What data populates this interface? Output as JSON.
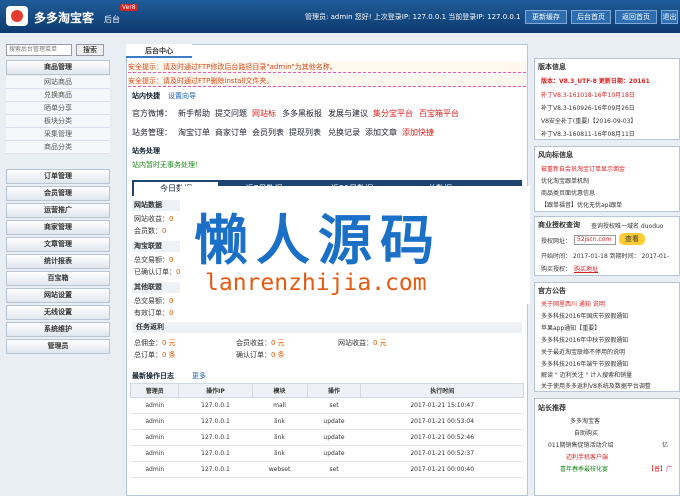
{
  "header": {
    "brand": "多多淘宝客",
    "brand_sub": "后台",
    "version_badge": "Ver8",
    "user_info": "管理员: admin 您好! 上次登录IP: 127.0.0.1 当前登录IP: 127.0.0.1",
    "buttons": [
      "更新缓存",
      "后台首页",
      "返回首页",
      "退出"
    ]
  },
  "sidebar": {
    "search_placeholder": "搜索后台管理菜单",
    "search_button": "搜索",
    "groups": [
      {
        "label": "商品管理",
        "items": [
          "网站商品",
          "兑换商品",
          "晒单分享",
          "板块分类",
          "采集管理",
          "商品分类"
        ]
      },
      {
        "label": "订单管理",
        "items": []
      },
      {
        "label": "会员管理",
        "items": []
      },
      {
        "label": "运营推广",
        "items": []
      },
      {
        "label": "商家管理",
        "items": []
      },
      {
        "label": "文章管理",
        "items": []
      },
      {
        "label": "统计报表",
        "items": []
      },
      {
        "label": "百宝箱",
        "items": []
      },
      {
        "label": "网站设置",
        "items": []
      },
      {
        "label": "无线设置",
        "items": []
      },
      {
        "label": "系统维护",
        "items": []
      },
      {
        "label": "管理员",
        "items": []
      }
    ]
  },
  "center": {
    "tab": "后台中心",
    "notices": [
      "安全提示：请及时通过FTP修改后台路径目录\"admin\"为其他名称。",
      "安全提示：请及时通过FTP删除install文件夹。"
    ],
    "shortcut_title": "站内快捷",
    "shortcut_link": "设置向导",
    "row1": [
      "官方微博：",
      "新手帮助",
      "提交问题",
      "网站标",
      "多多黑板报",
      "发展与建议",
      "集分宝平台",
      "百宝箱平台"
    ],
    "row2": [
      "站务管理：",
      "淘宝订单",
      "商家订单",
      "会员列表",
      "提现列表",
      "兑换记录",
      "添加文章",
      "添加快捷"
    ],
    "process_title": "站务处理",
    "process_text": "站内暂时无事务处理！",
    "stat_tabs": [
      "今日数据",
      "近7日数据",
      "近30日数据",
      "总数据"
    ],
    "stat_groups": [
      {
        "title": "网站数据",
        "lines": [
          [
            "网站收益：",
            "0"
          ],
          [
            "会员数：",
            "0"
          ]
        ]
      },
      {
        "title": "淘宝联盟",
        "lines": [
          [
            "总交易额：",
            "0"
          ],
          [
            "已确认订单：",
            "0"
          ]
        ]
      },
      {
        "title": "其他联盟",
        "lines": [
          [
            "总交易额：",
            "0"
          ],
          [
            "有效订单：",
            "0"
          ]
        ]
      }
    ],
    "task_title": "任务返利",
    "task_lines": [
      [
        "总佣金：",
        "0 元"
      ],
      [
        "会员收益：",
        "0 元"
      ],
      [
        "网站收益：",
        "0 元"
      ],
      [
        "总订单：",
        "0 条"
      ],
      [
        "确认订单：",
        "0 条"
      ]
    ],
    "log_title": "最新操作日志",
    "log_more": "更多",
    "log_headers": [
      "管理员",
      "操作IP",
      "模块",
      "操作",
      "执行时间"
    ],
    "log_rows": [
      [
        "admin",
        "127.0.0.1",
        "mall",
        "set",
        "2017-01-21 15:10:47"
      ],
      [
        "admin",
        "127.0.0.1",
        "link",
        "update",
        "2017-01-21 00:53:04"
      ],
      [
        "admin",
        "127.0.0.1",
        "link",
        "update",
        "2017-01-21 00:52:46"
      ],
      [
        "admin",
        "127.0.0.1",
        "link",
        "update",
        "2017-01-21 00:52:37"
      ],
      [
        "admin",
        "127.0.0.1",
        "webset",
        "set",
        "2017-01-21 00:00:40"
      ]
    ]
  },
  "right": {
    "version_title": "版本信息",
    "version_line": "版本：V8.3_UTF-8 更新日期：20161",
    "version_items": [
      "补丁V8.3-161018-16年10月18日",
      "补丁V8.3-160926-16年09月26日",
      "V8安全补丁(重要)【2016-09-03】",
      "补丁V8.3-160811-16年08月11日"
    ],
    "risk_title": "风向标信息",
    "risk_items": [
      "被重新自会员淘宝订单显示佣金",
      "优化淘宝跟单机制",
      "商品类页面优惠信息",
      "【跟单福音】优化无忧api跟单"
    ],
    "auth_title": "商业授权查询",
    "auth_query": "查询授权唯一域名 duoduo",
    "auth_domain_label": "授权网址：",
    "auth_domain_value": "52jscn.com",
    "auth_button": "查看",
    "auth_dates": "开始时间： 2017-01-18  到期时间： 2017-01-",
    "auth_status_label": "购买授权：",
    "auth_status_value": "购买地址",
    "official_title": "官方公告",
    "official_items": [
      "关于网里西川 通知 说明",
      "多多科技2016年国庆节放假通知",
      "苹果app通知【重要】",
      "多多科技2016年中秋节放假通知",
      "关于最近淘宝联络不停用的说明",
      "多多科技2016年端午节放假通知",
      "解读 \" 迈利关注 \" 计入搜索和销量",
      "关于使用多多返利V8系统及数据平台调整"
    ],
    "recommend_title": "站长推荐",
    "recommend_items": [
      "多多淘宝客",
      "自助购买",
      "011期销售促销活动介绍",
      "迈利手机客户端",
      "喜年春季最核化宴"
    ],
    "recommend_side": [
      "亿",
      "【普】广"
    ]
  },
  "watermark": {
    "cn": "懒人源码",
    "en": "lanrenzhijia.com"
  }
}
